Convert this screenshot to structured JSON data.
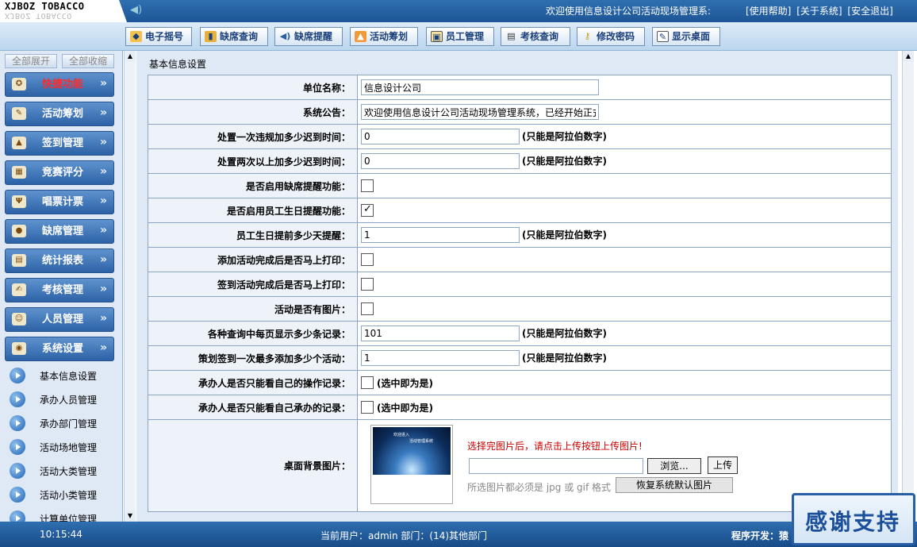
{
  "brand": {
    "line1": "XJBOZ TOBACCO"
  },
  "header": {
    "welcome": "欢迎使用信息设计公司活动现场管理系:",
    "links": [
      "[使用帮助]",
      "[关于系统]",
      "[安全退出]"
    ]
  },
  "toolbar": {
    "buttons": [
      "电子摇号",
      "缺席查询",
      "缺席提醒",
      "活动筹划",
      "员工管理",
      "考核查询",
      "修改密码",
      "显示桌面"
    ]
  },
  "sidebar": {
    "expand_all": "全部展开",
    "collapse_all": "全部收缩",
    "items": [
      "快捷功能",
      "活动筹划",
      "签到管理",
      "竞赛评分",
      "唱票计票",
      "缺席管理",
      "统计报表",
      "考核管理",
      "人员管理",
      "系统设置"
    ],
    "subitems": [
      "基本信息设置",
      "承办人员管理",
      "承办部门管理",
      "活动场地管理",
      "活动大类管理",
      "活动小类管理",
      "计算单位管理"
    ]
  },
  "main": {
    "title": "基本信息设置",
    "rows": [
      {
        "label": "单位名称：",
        "value": "信息设计公司"
      },
      {
        "label": "系统公告：",
        "value": "欢迎使用信息设计公司活动现场管理系统，已经开始正式"
      },
      {
        "label": "处置一次违规加多少迟到时间：",
        "value": "0",
        "hint": "(只能是阿拉伯数字)"
      },
      {
        "label": "处置两次以上加多少迟到时间：",
        "value": "0",
        "hint": "(只能是阿拉伯数字)"
      },
      {
        "label": "是否启用缺席提醒功能：",
        "checked": false
      },
      {
        "label": "是否启用员工生日提醒功能：",
        "checked": true
      },
      {
        "label": "员工生日提前多少天提醒：",
        "value": "1",
        "hint": "(只能是阿拉伯数字)"
      },
      {
        "label": "添加活动完成后是否马上打印：",
        "checked": false
      },
      {
        "label": "签到活动完成后是否马上打印：",
        "checked": false
      },
      {
        "label": "活动是否有图片：",
        "checked": false
      },
      {
        "label": "各种查询中每页显示多少条记录：",
        "value": "101",
        "hint": "(只能是阿拉伯数字)"
      },
      {
        "label": "策划签到一次最多添加多少个活动：",
        "value": "1",
        "hint": "(只能是阿拉伯数字)"
      },
      {
        "label": "承办人是否只能看自己的操作记录：",
        "checked": false,
        "hint": "(选中即为是)"
      },
      {
        "label": "承办人是否只能看自己承办的记录：",
        "checked": false,
        "hint": "(选中即为是)"
      }
    ],
    "background": {
      "label": "桌面背景图片：",
      "thumb_line1": "欢迎进入",
      "thumb_line2": "活动管理系统",
      "upload_msg": "选择完图片后，请点击上传按钮上传图片!",
      "browse": "浏览...",
      "upload": "上传",
      "format_note": "所选图片都必须是 jpg 或 gif 格式",
      "restore": "恢复系统默认图片"
    }
  },
  "status": {
    "time": "10:15:44",
    "user": "当前用户：admin   部门：(14)其他部门",
    "dev": "程序开发：猿"
  },
  "overlay": {
    "thanks": "感谢支持"
  }
}
